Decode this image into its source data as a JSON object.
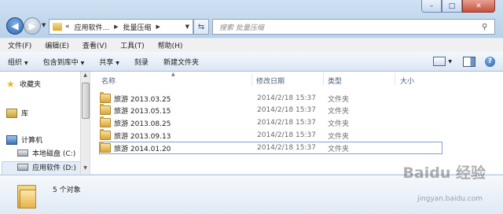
{
  "window": {
    "caption_min": "–",
    "caption_max": "□",
    "caption_close": "✕"
  },
  "address": {
    "prefix": "«",
    "segments": [
      "应用软件...",
      "批量压缩"
    ],
    "search_placeholder": "搜索 批量压缩"
  },
  "menubar": [
    "文件(F)",
    "编辑(E)",
    "查看(V)",
    "工具(T)",
    "帮助(H)"
  ],
  "commands": {
    "organize": "组织",
    "include_library": "包含到库中",
    "share": "共享",
    "burn": "刻录",
    "new_folder": "新建文件夹"
  },
  "navpane": {
    "favorites": "收藏夹",
    "libraries": "库",
    "computer": "计算机",
    "drive_c": "本地磁盘 (C:)",
    "drive_d": "应用软件 (D:)"
  },
  "columns": {
    "name": "名称",
    "date": "修改日期",
    "type": "类型",
    "size": "大小"
  },
  "files": [
    {
      "name": "旅游 2013.03.25",
      "date": "2014/2/18 15:37",
      "type": "文件夹"
    },
    {
      "name": "旅游 2013.05.15",
      "date": "2014/2/18 15:37",
      "type": "文件夹"
    },
    {
      "name": "旅游 2013.08.25",
      "date": "2014/2/18 15:37",
      "type": "文件夹"
    },
    {
      "name": "旅游 2013.09.13",
      "date": "2014/2/18 15:37",
      "type": "文件夹"
    },
    {
      "name": "旅游 2014.01.20",
      "date": "2014/2/18 15:37",
      "type": "文件夹"
    }
  ],
  "status": {
    "count": "5 个对象"
  },
  "watermark": {
    "logo": "Baidu 经验",
    "url": "jingyan.baidu.com"
  },
  "colors": {
    "accent": "#2a5ca0",
    "folder": "#d8a43a",
    "selection_border": "#7da2ce"
  }
}
